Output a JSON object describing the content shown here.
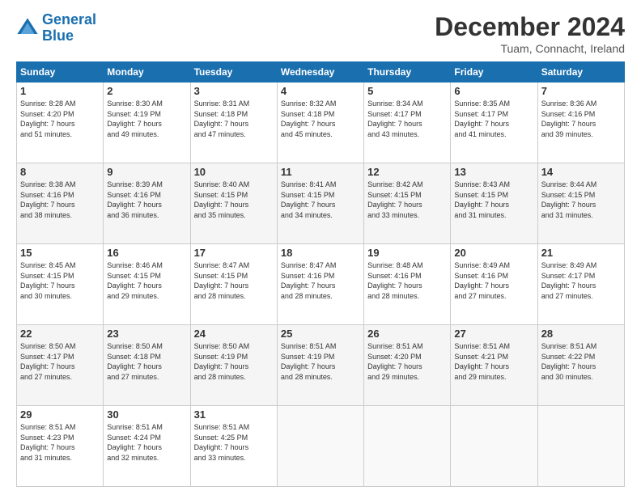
{
  "header": {
    "logo_line1": "General",
    "logo_line2": "Blue",
    "month_title": "December 2024",
    "location": "Tuam, Connacht, Ireland"
  },
  "weekdays": [
    "Sunday",
    "Monday",
    "Tuesday",
    "Wednesday",
    "Thursday",
    "Friday",
    "Saturday"
  ],
  "weeks": [
    [
      {
        "day": "1",
        "text": "Sunrise: 8:28 AM\nSunset: 4:20 PM\nDaylight: 7 hours\nand 51 minutes."
      },
      {
        "day": "2",
        "text": "Sunrise: 8:30 AM\nSunset: 4:19 PM\nDaylight: 7 hours\nand 49 minutes."
      },
      {
        "day": "3",
        "text": "Sunrise: 8:31 AM\nSunset: 4:18 PM\nDaylight: 7 hours\nand 47 minutes."
      },
      {
        "day": "4",
        "text": "Sunrise: 8:32 AM\nSunset: 4:18 PM\nDaylight: 7 hours\nand 45 minutes."
      },
      {
        "day": "5",
        "text": "Sunrise: 8:34 AM\nSunset: 4:17 PM\nDaylight: 7 hours\nand 43 minutes."
      },
      {
        "day": "6",
        "text": "Sunrise: 8:35 AM\nSunset: 4:17 PM\nDaylight: 7 hours\nand 41 minutes."
      },
      {
        "day": "7",
        "text": "Sunrise: 8:36 AM\nSunset: 4:16 PM\nDaylight: 7 hours\nand 39 minutes."
      }
    ],
    [
      {
        "day": "8",
        "text": "Sunrise: 8:38 AM\nSunset: 4:16 PM\nDaylight: 7 hours\nand 38 minutes."
      },
      {
        "day": "9",
        "text": "Sunrise: 8:39 AM\nSunset: 4:16 PM\nDaylight: 7 hours\nand 36 minutes."
      },
      {
        "day": "10",
        "text": "Sunrise: 8:40 AM\nSunset: 4:15 PM\nDaylight: 7 hours\nand 35 minutes."
      },
      {
        "day": "11",
        "text": "Sunrise: 8:41 AM\nSunset: 4:15 PM\nDaylight: 7 hours\nand 34 minutes."
      },
      {
        "day": "12",
        "text": "Sunrise: 8:42 AM\nSunset: 4:15 PM\nDaylight: 7 hours\nand 33 minutes."
      },
      {
        "day": "13",
        "text": "Sunrise: 8:43 AM\nSunset: 4:15 PM\nDaylight: 7 hours\nand 31 minutes."
      },
      {
        "day": "14",
        "text": "Sunrise: 8:44 AM\nSunset: 4:15 PM\nDaylight: 7 hours\nand 31 minutes."
      }
    ],
    [
      {
        "day": "15",
        "text": "Sunrise: 8:45 AM\nSunset: 4:15 PM\nDaylight: 7 hours\nand 30 minutes."
      },
      {
        "day": "16",
        "text": "Sunrise: 8:46 AM\nSunset: 4:15 PM\nDaylight: 7 hours\nand 29 minutes."
      },
      {
        "day": "17",
        "text": "Sunrise: 8:47 AM\nSunset: 4:15 PM\nDaylight: 7 hours\nand 28 minutes."
      },
      {
        "day": "18",
        "text": "Sunrise: 8:47 AM\nSunset: 4:16 PM\nDaylight: 7 hours\nand 28 minutes."
      },
      {
        "day": "19",
        "text": "Sunrise: 8:48 AM\nSunset: 4:16 PM\nDaylight: 7 hours\nand 28 minutes."
      },
      {
        "day": "20",
        "text": "Sunrise: 8:49 AM\nSunset: 4:16 PM\nDaylight: 7 hours\nand 27 minutes."
      },
      {
        "day": "21",
        "text": "Sunrise: 8:49 AM\nSunset: 4:17 PM\nDaylight: 7 hours\nand 27 minutes."
      }
    ],
    [
      {
        "day": "22",
        "text": "Sunrise: 8:50 AM\nSunset: 4:17 PM\nDaylight: 7 hours\nand 27 minutes."
      },
      {
        "day": "23",
        "text": "Sunrise: 8:50 AM\nSunset: 4:18 PM\nDaylight: 7 hours\nand 27 minutes."
      },
      {
        "day": "24",
        "text": "Sunrise: 8:50 AM\nSunset: 4:19 PM\nDaylight: 7 hours\nand 28 minutes."
      },
      {
        "day": "25",
        "text": "Sunrise: 8:51 AM\nSunset: 4:19 PM\nDaylight: 7 hours\nand 28 minutes."
      },
      {
        "day": "26",
        "text": "Sunrise: 8:51 AM\nSunset: 4:20 PM\nDaylight: 7 hours\nand 29 minutes."
      },
      {
        "day": "27",
        "text": "Sunrise: 8:51 AM\nSunset: 4:21 PM\nDaylight: 7 hours\nand 29 minutes."
      },
      {
        "day": "28",
        "text": "Sunrise: 8:51 AM\nSunset: 4:22 PM\nDaylight: 7 hours\nand 30 minutes."
      }
    ],
    [
      {
        "day": "29",
        "text": "Sunrise: 8:51 AM\nSunset: 4:23 PM\nDaylight: 7 hours\nand 31 minutes."
      },
      {
        "day": "30",
        "text": "Sunrise: 8:51 AM\nSunset: 4:24 PM\nDaylight: 7 hours\nand 32 minutes."
      },
      {
        "day": "31",
        "text": "Sunrise: 8:51 AM\nSunset: 4:25 PM\nDaylight: 7 hours\nand 33 minutes."
      },
      {
        "day": "",
        "text": ""
      },
      {
        "day": "",
        "text": ""
      },
      {
        "day": "",
        "text": ""
      },
      {
        "day": "",
        "text": ""
      }
    ]
  ]
}
